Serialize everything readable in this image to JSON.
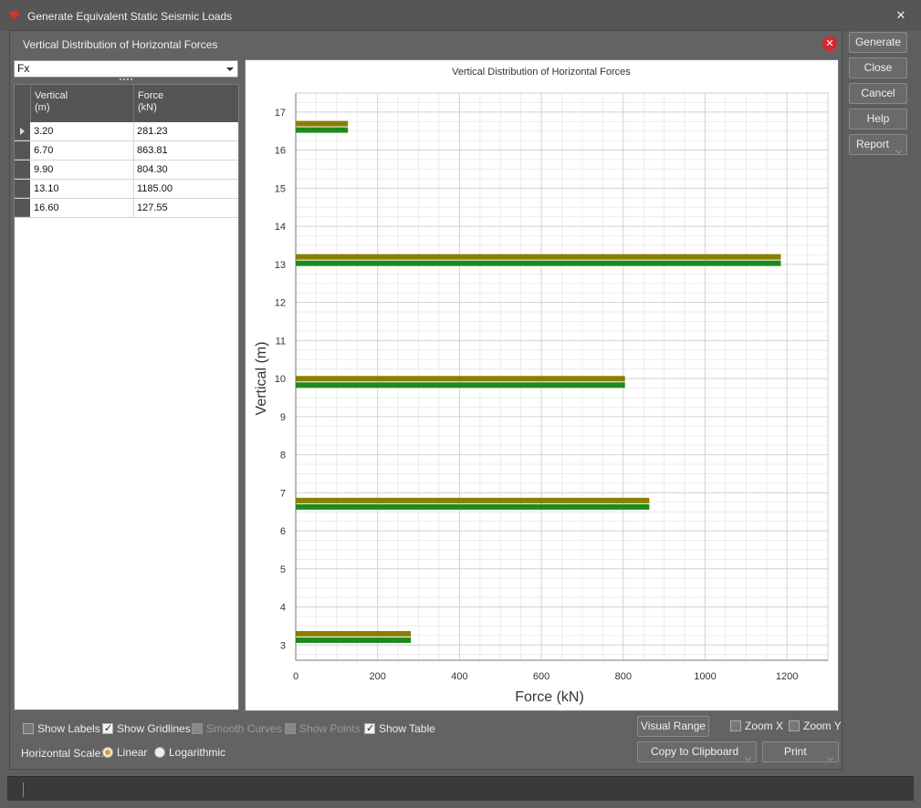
{
  "window": {
    "title": "Generate Equivalent Static Seismic Loads"
  },
  "panel": {
    "title": "Vertical Distribution of Horizontal Forces"
  },
  "component": {
    "selected": "Fx"
  },
  "table": {
    "headers": [
      {
        "line1": "Vertical",
        "line2": "(m)"
      },
      {
        "line1": "Force",
        "line2": "(kN)"
      }
    ],
    "rows": [
      {
        "vertical": "3.20",
        "force": "281.23"
      },
      {
        "vertical": "6.70",
        "force": "863.81"
      },
      {
        "vertical": "9.90",
        "force": "804.30"
      },
      {
        "vertical": "13.10",
        "force": "1185.00"
      },
      {
        "vertical": "16.60",
        "force": "127.55"
      }
    ]
  },
  "chart_data": {
    "type": "bar",
    "orientation": "horizontal",
    "title": "Vertical Distribution of Horizontal Forces",
    "xlabel": "Force (kN)",
    "ylabel": "Vertical (m)",
    "xlim": [
      0,
      1300
    ],
    "ylim": [
      2.6,
      17.5
    ],
    "x_ticks": [
      0,
      200,
      400,
      600,
      800,
      1000,
      1200
    ],
    "y_ticks": [
      3,
      4,
      5,
      6,
      7,
      8,
      9,
      10,
      11,
      12,
      13,
      14,
      15,
      16,
      17
    ],
    "grid": true,
    "categories": [
      3.2,
      6.7,
      9.9,
      13.1,
      16.6
    ],
    "series": [
      {
        "values": [
          281.23,
          863.81,
          804.3,
          1185.0,
          127.55
        ],
        "color": "#8a8000"
      },
      {
        "values": [
          281.23,
          863.81,
          804.3,
          1185.0,
          127.55
        ],
        "color": "#1e8a1e"
      }
    ]
  },
  "buttons": {
    "generate": "Generate",
    "close": "Close",
    "cancel": "Cancel",
    "help": "Help",
    "report": "Report",
    "visual_range": "Visual Range",
    "copy_clipboard": "Copy to Clipboard",
    "print": "Print"
  },
  "options": {
    "show_labels": "Show Labels",
    "show_gridlines": "Show Gridlines",
    "smooth_curves": "Smooth Curves",
    "show_points": "Show Points",
    "show_table": "Show Table",
    "zoom_x": "Zoom X",
    "zoom_y": "Zoom Y",
    "horizontal_scale": "Horizontal Scale:",
    "linear": "Linear",
    "logarithmic": "Logarithmic"
  },
  "colors": {
    "accent": "#e89b1c",
    "close_red": "#d9262b"
  }
}
